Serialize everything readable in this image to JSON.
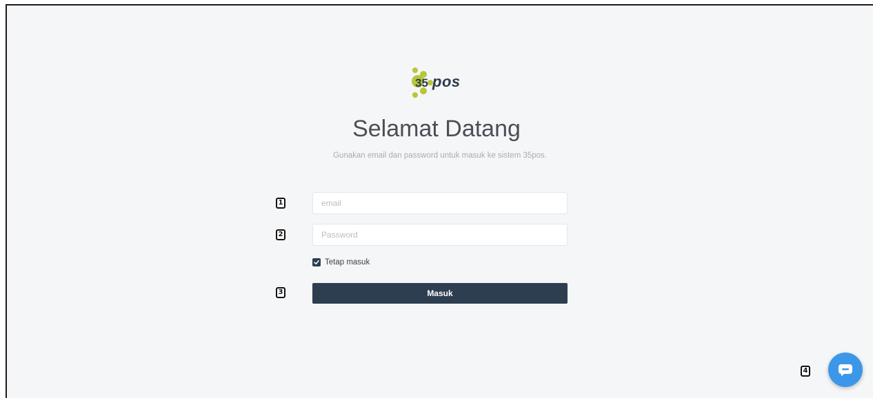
{
  "logo": {
    "number": "35",
    "text": "pos",
    "colors": {
      "dots": "#b7c63a",
      "text": "#2b3a4a"
    }
  },
  "header": {
    "title": "Selamat Datang",
    "subtitle": "Gunakan email dan password untuk masuk ke sistem 35pos."
  },
  "form": {
    "email": {
      "placeholder": "email",
      "value": ""
    },
    "password": {
      "placeholder": "Password",
      "value": ""
    },
    "remember": {
      "label": "Tetap masuk",
      "checked": true
    },
    "submit_label": "Masuk"
  },
  "annotations": {
    "m1": "1",
    "m2": "2",
    "m3": "3",
    "m4": "4"
  },
  "chat_widget": {
    "icon": "chat-icon",
    "color": "#3d97e8"
  },
  "theme": {
    "primary": "#2d3e50",
    "background": "#f5f6f8"
  }
}
